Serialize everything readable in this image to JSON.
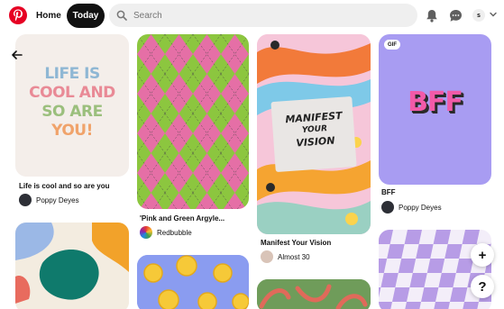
{
  "header": {
    "home_label": "Home",
    "today_label": "Today",
    "search_placeholder": "Search",
    "avatar_initial": "s",
    "brand_color": "#e60023"
  },
  "pins": [
    {
      "image_text": [
        "LIFE IS",
        "COOL AND",
        "SO ARE",
        "YOU!"
      ],
      "title": "Life is cool and so are you",
      "user": "Poppy Deyes"
    },
    {
      "title": "'Pink and Green Argyle...",
      "user": "Redbubble"
    },
    {
      "image_text": [
        "MANIFEST",
        "YOUR",
        "VISION"
      ],
      "title": "Manifest Your Vision",
      "user": "Almost 30"
    },
    {
      "badge": "GIF",
      "image_text": "BFF",
      "title": "BFF",
      "user": "Poppy Deyes"
    },
    {
      "image": "abstract-blobs"
    },
    {
      "image": "lemons"
    },
    {
      "image": "peppers"
    },
    {
      "image": "wavy-checker"
    }
  ],
  "fabs": {
    "add": "+",
    "help": "?"
  }
}
